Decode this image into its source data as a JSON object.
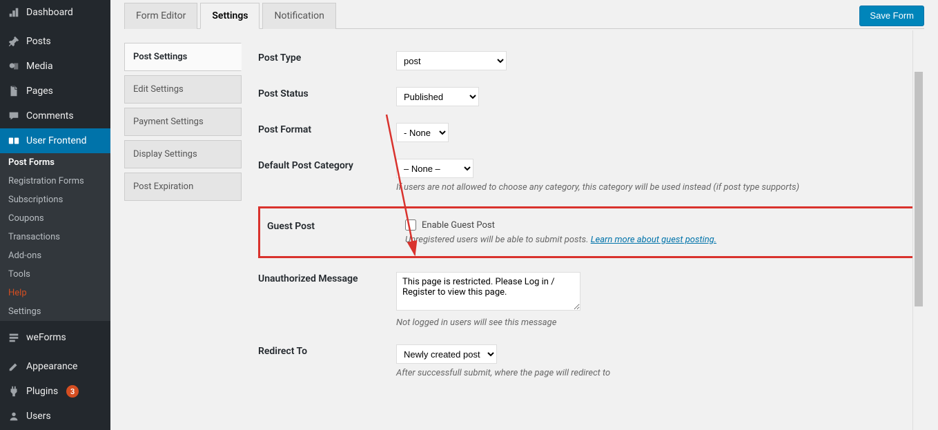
{
  "sidebar": {
    "dashboard": "Dashboard",
    "posts": "Posts",
    "media": "Media",
    "pages": "Pages",
    "comments": "Comments",
    "user_frontend": "User Frontend",
    "submenu": {
      "post_forms": "Post Forms",
      "registration_forms": "Registration Forms",
      "subscriptions": "Subscriptions",
      "coupons": "Coupons",
      "transactions": "Transactions",
      "addons": "Add-ons",
      "tools": "Tools",
      "help": "Help",
      "settings": "Settings"
    },
    "weforms": "weForms",
    "appearance": "Appearance",
    "plugins": "Plugins",
    "plugins_badge": "3",
    "users": "Users"
  },
  "tabs": {
    "form_editor": "Form Editor",
    "settings": "Settings",
    "notification": "Notification"
  },
  "buttons": {
    "save_form": "Save Form"
  },
  "settings_nav": {
    "post_settings": "Post Settings",
    "edit_settings": "Edit Settings",
    "payment_settings": "Payment Settings",
    "display_settings": "Display Settings",
    "post_expiration": "Post Expiration"
  },
  "form": {
    "post_type": {
      "label": "Post Type",
      "value": "post"
    },
    "post_status": {
      "label": "Post Status",
      "value": "Published"
    },
    "post_format": {
      "label": "Post Format",
      "value": "- None -"
    },
    "default_cat": {
      "label": "Default Post Category",
      "value": "– None –",
      "desc": "If users are not allowed to choose any category, this category will be used instead (if post type supports)"
    },
    "guest_post": {
      "label": "Guest Post",
      "checkbox_label": "Enable Guest Post",
      "desc_prefix": "Unregistered users will be able to submit posts. ",
      "link": "Learn more about guest posting."
    },
    "unauth": {
      "label": "Unauthorized Message",
      "value": "This page is restricted. Please Log in / Register to view this page.",
      "desc": "Not logged in users will see this message"
    },
    "redirect": {
      "label": "Redirect To",
      "value": "Newly created post",
      "desc": "After successfull submit, where the page will redirect to"
    }
  }
}
